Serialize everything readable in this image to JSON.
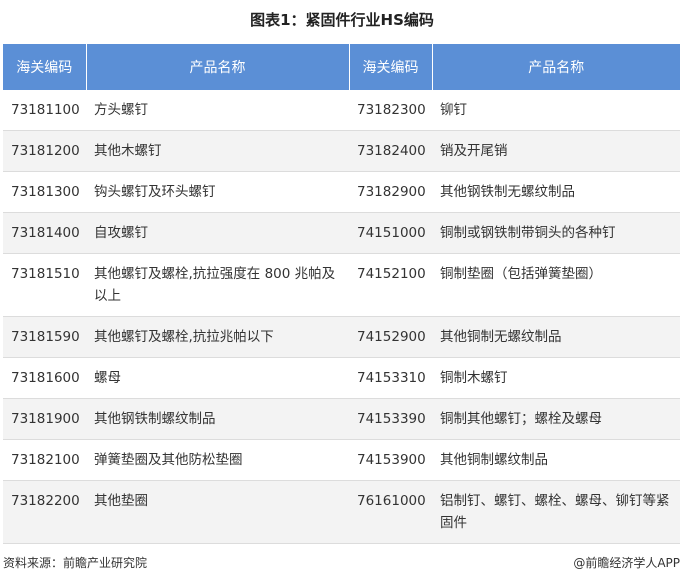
{
  "title": "图表1：紧固件行业HS编码",
  "table": {
    "headers": [
      "海关编码",
      "产品名称",
      "海关编码",
      "产品名称"
    ],
    "rows": [
      [
        "73181100",
        "方头螺钉",
        "73182300",
        "铆钉"
      ],
      [
        "73181200",
        "其他木螺钉",
        "73182400",
        "销及开尾销"
      ],
      [
        "73181300",
        "钩头螺钉及环头螺钉",
        "73182900",
        "其他钢铁制无螺纹制品"
      ],
      [
        "73181400",
        "自攻螺钉",
        "74151000",
        "铜制或钢铁制带铜头的各种钉"
      ],
      [
        "73181510",
        "其他螺钉及螺栓,抗拉强度在 800 兆帕及以上",
        "74152100",
        "铜制垫圈（包括弹簧垫圈）"
      ],
      [
        "73181590",
        "其他螺钉及螺栓,抗拉兆帕以下",
        "74152900",
        "其他铜制无螺纹制品"
      ],
      [
        "73181600",
        "螺母",
        "74153310",
        "铜制木螺钉"
      ],
      [
        "73181900",
        "其他钢铁制螺纹制品",
        "74153390",
        "铜制其他螺钉；螺栓及螺母"
      ],
      [
        "73182100",
        "弹簧垫圈及其他防松垫圈",
        "74153900",
        "其他铜制螺纹制品"
      ],
      [
        "73182200",
        "其他垫圈",
        "76161000",
        "铝制钉、螺钉、螺栓、螺母、铆钉等紧固件"
      ]
    ]
  },
  "footer": {
    "source": "资料来源：前瞻产业研究院",
    "brand": "@前瞻经济学人APP"
  }
}
